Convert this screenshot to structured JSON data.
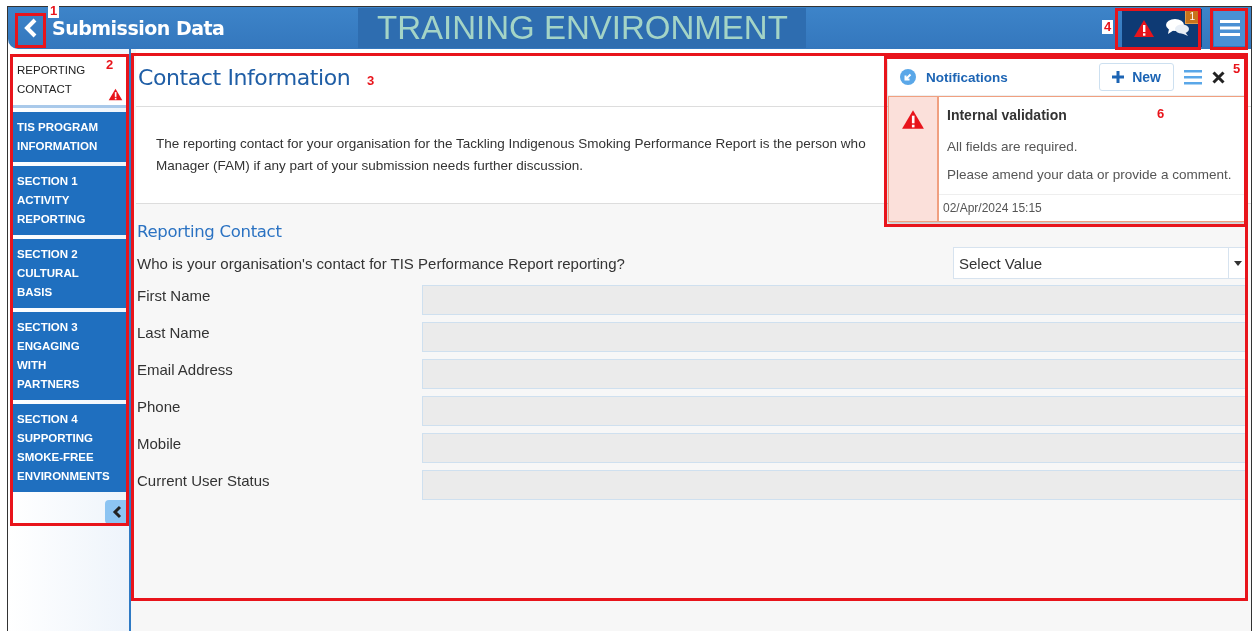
{
  "header": {
    "title": "Submission Data",
    "environment": "TRAINING ENVIRONMENT",
    "alert_badge": "1"
  },
  "sidebar": {
    "items": [
      {
        "label": "REPORTING CONTACT",
        "selected": true,
        "warning": true
      },
      {
        "label": "TIS PROGRAM INFORMATION",
        "selected": false,
        "warning": false
      },
      {
        "label": "SECTION 1 ACTIVITY REPORTING",
        "selected": false,
        "warning": false
      },
      {
        "label": "SECTION 2 CULTURAL BASIS",
        "selected": false,
        "warning": false
      },
      {
        "label": "SECTION 3 ENGAGING WITH PARTNERS",
        "selected": false,
        "warning": false
      },
      {
        "label": "SECTION 4 SUPPORTING SMOKE-FREE ENVIRONMENTS",
        "selected": false,
        "warning": false
      }
    ]
  },
  "content": {
    "title": "Contact Information",
    "intro_lines": [
      "The reporting contact for your organisation for the Tackling Indigenous Smoking Performance Report is the person who",
      "Manager (FAM) if any part of your submission needs further discussion."
    ],
    "section_title": "Reporting Contact",
    "question": "Who is your organisation's contact for TIS Performance Report reporting?",
    "select": {
      "placeholder": "Select Value"
    },
    "fields": [
      {
        "label": "First Name",
        "disabled": true
      },
      {
        "label": "Last Name",
        "disabled": true
      },
      {
        "label": "Email Address",
        "disabled": true
      },
      {
        "label": "Phone",
        "disabled": true
      },
      {
        "label": "Mobile",
        "disabled": true
      },
      {
        "label": "Current User Status",
        "disabled": true
      }
    ]
  },
  "notifications": {
    "title": "Notifications",
    "new_button": "New",
    "items": [
      {
        "title": "Internal validation",
        "lines": [
          "All fields are required.",
          "Please amend your data or provide a comment."
        ],
        "time": "02/Apr/2024 15:15"
      }
    ]
  },
  "annotations": [
    {
      "label": "1"
    },
    {
      "label": "2"
    },
    {
      "label": "3"
    },
    {
      "label": "4"
    },
    {
      "label": "5"
    },
    {
      "label": "6"
    }
  ]
}
